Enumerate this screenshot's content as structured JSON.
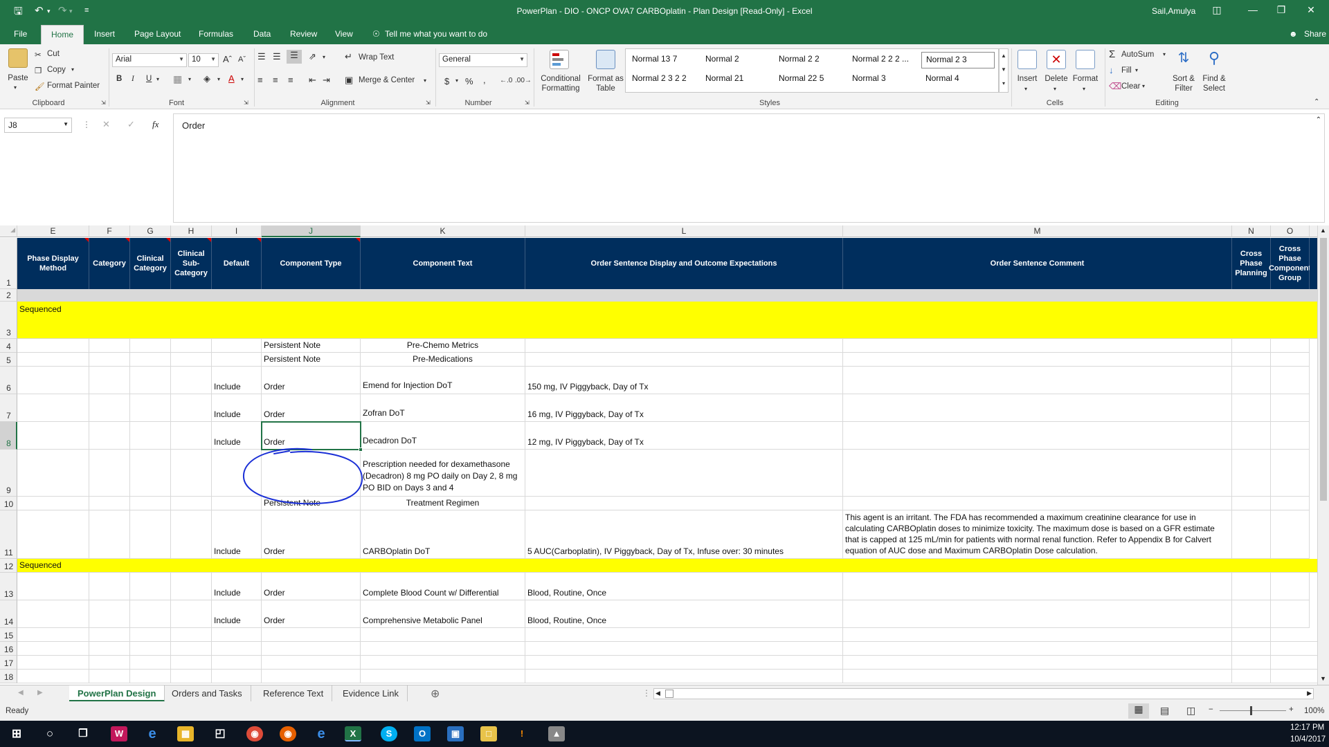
{
  "window": {
    "title": "PowerPlan - DIO - ONCP OVA7 CARBOplatin - Plan Design  [Read-Only]  -  Excel",
    "user": "Sail,Amulya"
  },
  "ribbon_tabs": [
    "File",
    "Home",
    "Insert",
    "Page Layout",
    "Formulas",
    "Data",
    "Review",
    "View"
  ],
  "tell_me": "Tell me what you want to do",
  "share": "Share",
  "clipboard": {
    "paste": "Paste",
    "cut": "Cut",
    "copy": "Copy",
    "format_painter": "Format Painter",
    "label": "Clipboard"
  },
  "font": {
    "name": "Arial",
    "size": "10",
    "label": "Font",
    "bold": "B",
    "italic": "I",
    "underline": "U"
  },
  "alignment": {
    "wrap": "Wrap Text",
    "merge": "Merge & Center",
    "label": "Alignment"
  },
  "number": {
    "format": "General",
    "label": "Number",
    "currency": "$",
    "percent": "%",
    "comma": ","
  },
  "styles": {
    "conditional": "Conditional Formatting",
    "format_table": "Format as Table",
    "items": [
      "Normal 13 7",
      "Normal 2",
      "Normal 2 2",
      "Normal 2 2 2 ...",
      "Normal 2 3",
      "Normal 2 3 2 2",
      "Normal 21",
      "Normal 22 5",
      "Normal 3",
      "Normal 4"
    ],
    "label": "Styles"
  },
  "cells": {
    "insert": "Insert",
    "delete": "Delete",
    "format": "Format",
    "label": "Cells"
  },
  "editing": {
    "autosum": "AutoSum",
    "fill": "Fill",
    "clear": "Clear",
    "sort": "Sort & Filter",
    "find": "Find & Select",
    "label": "Editing"
  },
  "formula_bar": {
    "name_box": "J8",
    "content": "Order"
  },
  "columns": [
    "E",
    "F",
    "G",
    "H",
    "I",
    "J",
    "K",
    "L",
    "M",
    "N",
    "O"
  ],
  "headers": {
    "E": "Phase Display Method",
    "F": "Category",
    "G": "Clinical Category",
    "H": "Clinical Sub-Category",
    "I": "Default",
    "J": "Component Type",
    "K": "Component Text",
    "L": "Order Sentence Display and Outcome Expectations",
    "M": "Order Sentence Comment",
    "N": "Cross Phase Planning",
    "O": "Cross Phase Component Group"
  },
  "rows": [
    "1",
    "2",
    "3",
    "4",
    "5",
    "6",
    "7",
    "8",
    "9",
    "10",
    "11",
    "12",
    "13",
    "14",
    "15",
    "16",
    "17",
    "18"
  ],
  "cells_data": {
    "r3": {
      "E": "Sequenced"
    },
    "r4": {
      "J": "Persistent Note",
      "K": "Pre-Chemo Metrics"
    },
    "r5": {
      "J": "Persistent Note",
      "K": "Pre-Medications"
    },
    "r6": {
      "I": "Include",
      "J": "Order",
      "K": "Emend for Injection DoT",
      "L": "150 mg, IV Piggyback, Day of Tx"
    },
    "r7": {
      "I": "Include",
      "J": "Order",
      "K": "Zofran DoT",
      "L": "16 mg, IV Piggyback, Day of Tx"
    },
    "r8": {
      "I": "Include",
      "J": "Order",
      "K": "Decadron DoT",
      "L": "12 mg, IV Piggyback, Day of Tx"
    },
    "r9": {
      "K": "Prescription needed for dexamethasone (Decadron) 8 mg PO daily on Day 2, 8 mg PO BID on Days 3 and 4"
    },
    "r10": {
      "J": "Persistent Note",
      "K": "Treatment Regimen"
    },
    "r11": {
      "I": "Include",
      "J": "Order",
      "K": "CARBOplatin DoT",
      "L": "5 AUC(Carboplatin), IV Piggyback, Day of Tx, Infuse over: 30 minutes",
      "M": "This agent is an irritant. The FDA has recommended a maximum creatinine clearance for use in calculating CARBOplatin doses to minimize toxicity. The maximum dose is based on a GFR estimate that is capped at 125 mL/min for patients with normal renal function. Refer to Appendix B for Calvert equation of AUC dose and Maximum CARBOplatin Dose calculation."
    },
    "r12": {
      "E": "Sequenced"
    },
    "r13": {
      "I": "Include",
      "J": "Order",
      "K": "Complete Blood Count w/ Differential",
      "L": "Blood, Routine, Once"
    },
    "r14": {
      "I": "Include",
      "J": "Order",
      "K": "Comprehensive Metabolic Panel",
      "L": "Blood, Routine, Once"
    }
  },
  "sheet_tabs": [
    "PowerPlan Design",
    "Orders and Tasks",
    "Reference Text",
    "Evidence Link"
  ],
  "status": {
    "ready": "Ready",
    "zoom": "100%"
  },
  "clock": {
    "time": "12:17 PM",
    "date": "10/4/2017"
  },
  "colors": {
    "excel_green": "#217346",
    "header_navy": "#002e5d",
    "highlight_yellow": "#ffff00",
    "annotation_blue": "#1a2fd6"
  }
}
